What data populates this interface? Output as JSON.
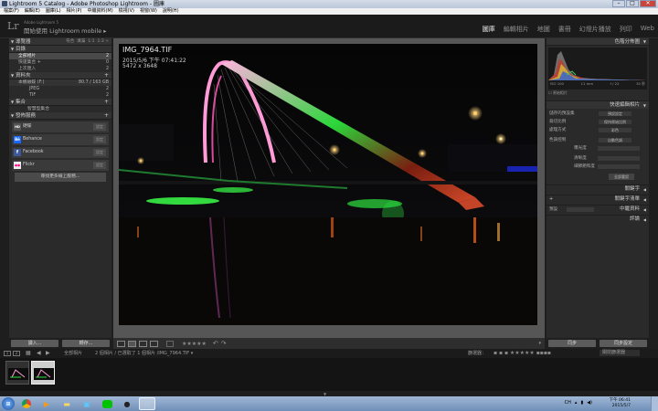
{
  "window": {
    "title": "Lightroom 5 Catalog - Adobe Photoshop Lightroom - 圖庫",
    "min": "–",
    "max": "□",
    "close": "✕"
  },
  "menu": [
    "檔案(F)",
    "編輯(E)",
    "圖庫(L)",
    "相片(P)",
    "中繼資料(M)",
    "檢視(V)",
    "視窗(W)",
    "說明(H)"
  ],
  "identity": {
    "small": "Adobe Lightroom 5",
    "main": "開始使用 Lightroom mobile ▸",
    "logo": "Lr"
  },
  "modules": [
    "圖庫",
    "編輯相片",
    "地圖",
    "書冊",
    "幻燈片播放",
    "列印",
    "Web"
  ],
  "left": {
    "navigator": {
      "title": "導覽器",
      "opts": [
        "符合",
        "填滿",
        "1:1",
        "1:3 ÷"
      ]
    },
    "catalog": {
      "title": "目錄",
      "items": [
        {
          "label": "全部相片",
          "count": "2"
        },
        {
          "label": "快速集合 +",
          "count": "0"
        },
        {
          "label": "上次匯入",
          "count": "2"
        }
      ]
    },
    "folders": {
      "title": "資料夾",
      "disk": "本機磁碟 (F:)",
      "disk_info": "80.7 / 163 GB",
      "items": [
        {
          "label": "JPEG",
          "count": "2"
        },
        {
          "label": "TIF",
          "count": "2"
        }
      ]
    },
    "collections": {
      "title": "集合",
      "items": [
        {
          "label": "智慧型集合",
          "count": ""
        }
      ]
    },
    "publish": {
      "title": "發佈服務",
      "items": [
        {
          "icon": "HD",
          "label": "硬碟",
          "btn": "設定"
        },
        {
          "icon": "Bē",
          "label": "Behance",
          "btn": "設定"
        },
        {
          "icon": "f",
          "label": "Facebook",
          "btn": "設定"
        },
        {
          "icon": "●●",
          "label": "Flickr",
          "btn": "設定"
        }
      ],
      "find_more": "尋找更多線上服務..."
    },
    "import_btn": "讀入...",
    "export_btn": "轉存..."
  },
  "photo": {
    "name": "IMG_7964.TIF",
    "date": "2015/5/6 下午 07:41:22",
    "dims": "5472 x 3648"
  },
  "toolbar": {
    "stars": "★★★★★"
  },
  "right": {
    "histogram": {
      "title": "色階分佈圖",
      "iso": "ISO 100",
      "focal": "11 mm",
      "fstop": "f / 22",
      "shutter": "30 秒",
      "orig": "原始相片"
    },
    "quick": {
      "title": "快速編輯相片",
      "rows": [
        {
          "label": "儲存的預設集",
          "value": "預設設定"
        },
        {
          "label": "裁切比例",
          "value": "保持原始比例"
        },
        {
          "label": "處理方式",
          "value": "彩色"
        }
      ],
      "tone_label": "色調控制",
      "tone_btn": "自動色調",
      "tone_rows": [
        "曝光度",
        "清晰度",
        "細節飽和度"
      ],
      "reset": "全部重設"
    },
    "sections": [
      "關鍵字",
      "關鍵字清單",
      "中繼資料",
      "評論"
    ],
    "meta_preset": "預設",
    "sync_btn": "同步",
    "sync_settings_btn": "同步設定"
  },
  "filmstrip": {
    "pages": [
      "1",
      "2"
    ],
    "source": "全部相片",
    "info": "2 個相片 / 已選取了 1 個相片 /IMG_7964.TIF ▾",
    "filter_label": "篩選器：",
    "filter_value": "關閉篩選器"
  },
  "taskbar": {
    "lang": "CH",
    "time": "下午 06:41",
    "date": "2015/5/7"
  }
}
